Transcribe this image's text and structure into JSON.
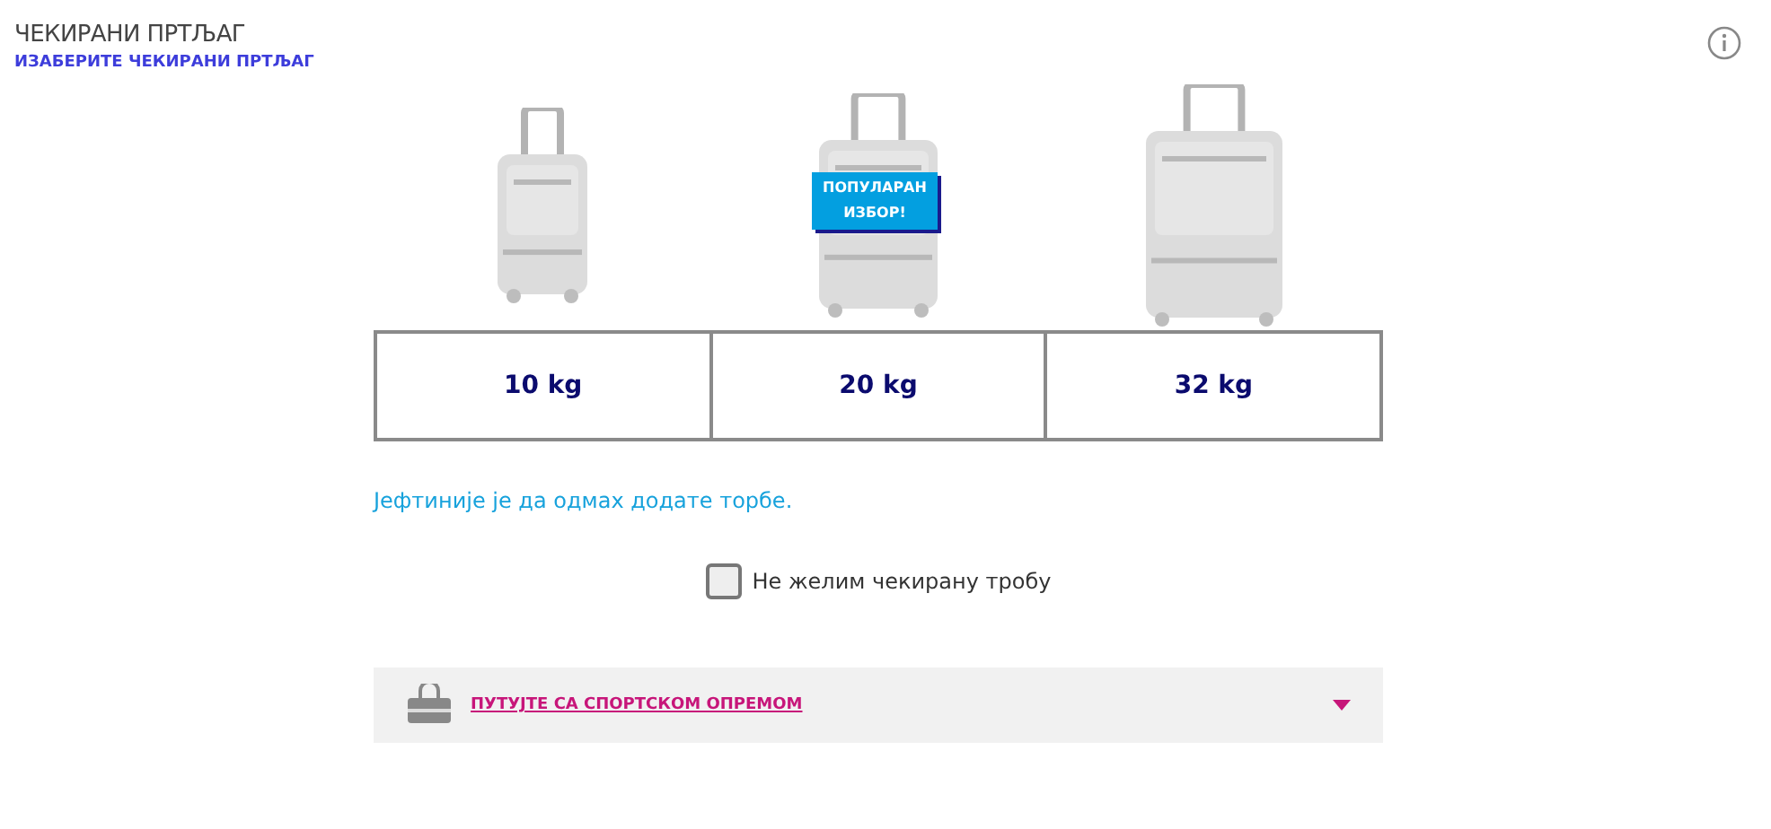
{
  "header": {
    "title": "ЧЕКИРАНИ ПРТЉАГ",
    "subtitle": "ИЗАБЕРИТЕ ЧЕКИРАНИ ПРТЉАГ"
  },
  "options": [
    {
      "kind": "small",
      "weight": "10 kg"
    },
    {
      "kind": "medium",
      "weight": "20 kg",
      "badge": "ПОПУЛАРАН ИЗБОР!"
    },
    {
      "kind": "large",
      "weight": "32 kg"
    }
  ],
  "note": "Јефтиније је да одмах додате торбе.",
  "opt_out": {
    "label": "Не желим чекирану тробу",
    "checked": false
  },
  "sport": {
    "label": "ПУТУЈТЕ СА СПОРТСКОМ ОПРЕМОМ",
    "expanded": false
  }
}
